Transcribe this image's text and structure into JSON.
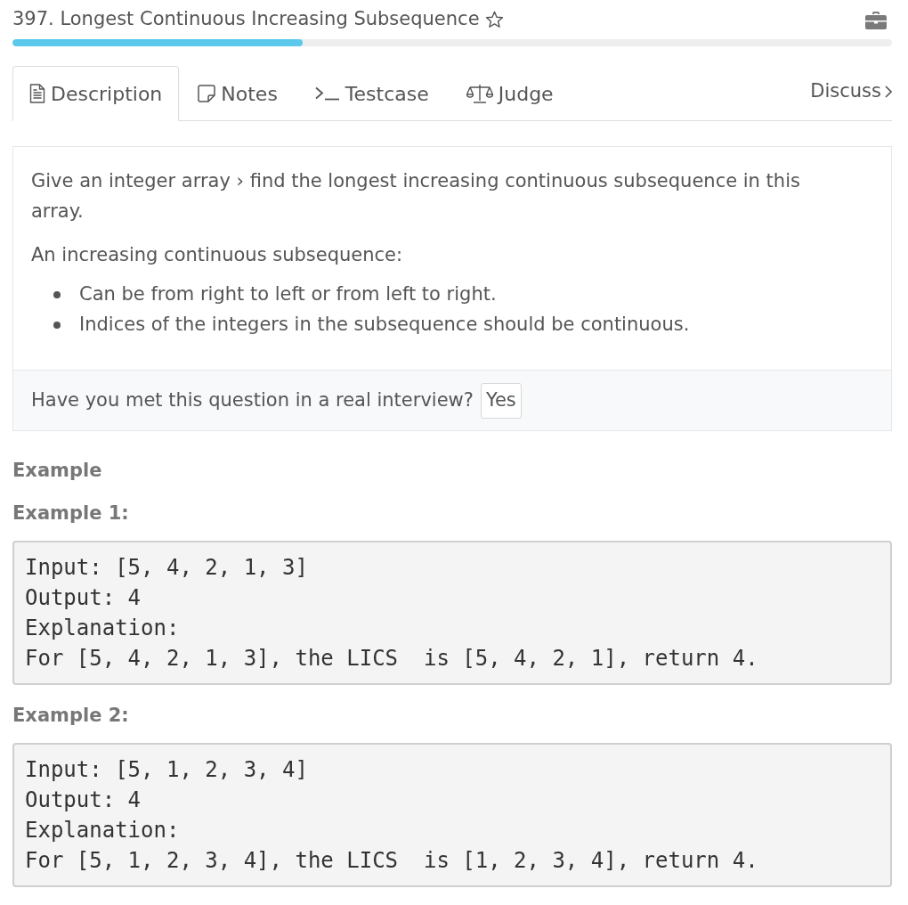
{
  "header": {
    "title": "397. Longest Continuous Increasing Subsequence",
    "favorited": false,
    "progress": {
      "level": 0.33
    }
  },
  "tabs": [
    {
      "label": "Description",
      "kind": "document",
      "selected": true
    },
    {
      "label": "Notes",
      "kind": "note",
      "selected": false
    },
    {
      "label": "Testcase",
      "kind": "terminal",
      "selected": false
    },
    {
      "label": "Judge",
      "kind": "scale",
      "selected": false
    }
  ],
  "discuss": {
    "label": "Discuss"
  },
  "description": {
    "paragraphs": [
      "Give an integer array › find the longest increasing continuous subsequence in this array.",
      "An increasing continuous subsequence:"
    ],
    "bullets": [
      "Can be from right to left or from left to right.",
      "Indices of the integers in the subsequence should be continuous."
    ]
  },
  "interview": {
    "question": "Have you met this question in a real interview?",
    "button": "Yes"
  },
  "example_heading": "Example",
  "examples": [
    {
      "title": "Example 1:",
      "lines": [
        "Input: [5, 4, 2, 1, 3]",
        "Output: 4",
        "Explanation:",
        "For [5, 4, 2, 1, 3], the LICS  is [5, 4, 2, 1], return 4."
      ]
    },
    {
      "title": "Example 2:",
      "lines": [
        "Input: [5, 1, 2, 3, 4]",
        "Output: 4",
        "Explanation:",
        "For [5, 1, 2, 3, 4], the LICS  is [1, 2, 3, 4], return 4."
      ]
    }
  ]
}
